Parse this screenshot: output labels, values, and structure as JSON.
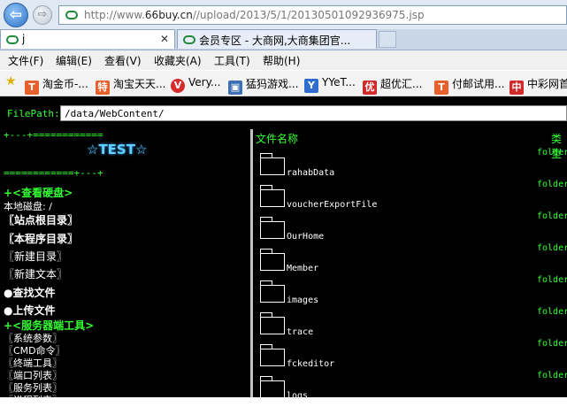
{
  "browser": {
    "address": {
      "prefix": "http://www.",
      "domain": "66buy.cn",
      "path": "//upload/2013/5/1/20130501092936975.jsp"
    },
    "tabs": [
      {
        "label": "j",
        "close": "✕"
      },
      {
        "label": "会员专区 - 大商网,大商集团官..."
      }
    ],
    "menu": [
      "文件(F)",
      "编辑(E)",
      "查看(V)",
      "收藏夹(A)",
      "工具(T)",
      "帮助(H)"
    ],
    "favorites": [
      {
        "label": "淘金币-...",
        "icon": "T",
        "color": "#e8602c"
      },
      {
        "label": "淘宝天天...",
        "icon": "特",
        "color": "#e8602c"
      },
      {
        "label": "Very...",
        "icon": "V",
        "color": "#d62b2b"
      },
      {
        "label": "猛犸游戏...",
        "icon": "▣",
        "color": "#3c6fb4"
      },
      {
        "label": "YYeT...",
        "icon": "Y",
        "color": "#2f6ed0"
      },
      {
        "label": "超优汇...",
        "icon": "优",
        "color": "#d12a2a"
      },
      {
        "label": "付邮试用...",
        "icon": "T",
        "color": "#e8602c"
      },
      {
        "label": "中彩网首",
        "icon": "中",
        "color": "#d12a2a"
      }
    ]
  },
  "page": {
    "filepath_label": "FilePath:",
    "filepath_value": "/data/WebContent/",
    "left": {
      "border_top": "+---+============",
      "test": "☆TEST☆",
      "border_bottom": "============+---+",
      "view_disk": "+<查看硬盘>",
      "local_disk": "本地磁盘: /",
      "site_root": "〖站点根目录〗",
      "program_dir": "〖本程序目录〗",
      "new_dir": "〖新建目录〗",
      "new_text": "〖新建文本〗",
      "find_file": "●查找文件",
      "upload_file": "●上传文件",
      "server_tools": "+<服务器端工具>",
      "tools": [
        "〖系统参数〗",
        "〖CMD命令〗",
        "〖终端工具〗",
        "〖端口列表〗",
        "〖服务列表〗",
        "〖进程列表〗"
      ]
    },
    "right": {
      "col_name": "文件名称",
      "col_type": "类型",
      "files": [
        {
          "name": "rahabData",
          "type": "folder"
        },
        {
          "name": "voucherExportFile",
          "type": "folder"
        },
        {
          "name": "OurHome",
          "type": "folder"
        },
        {
          "name": "Member",
          "type": "folder"
        },
        {
          "name": "images",
          "type": "folder"
        },
        {
          "name": "trace",
          "type": "folder"
        },
        {
          "name": "fckeditor",
          "type": "folder"
        },
        {
          "name": "logs",
          "type": "folder"
        }
      ]
    }
  }
}
